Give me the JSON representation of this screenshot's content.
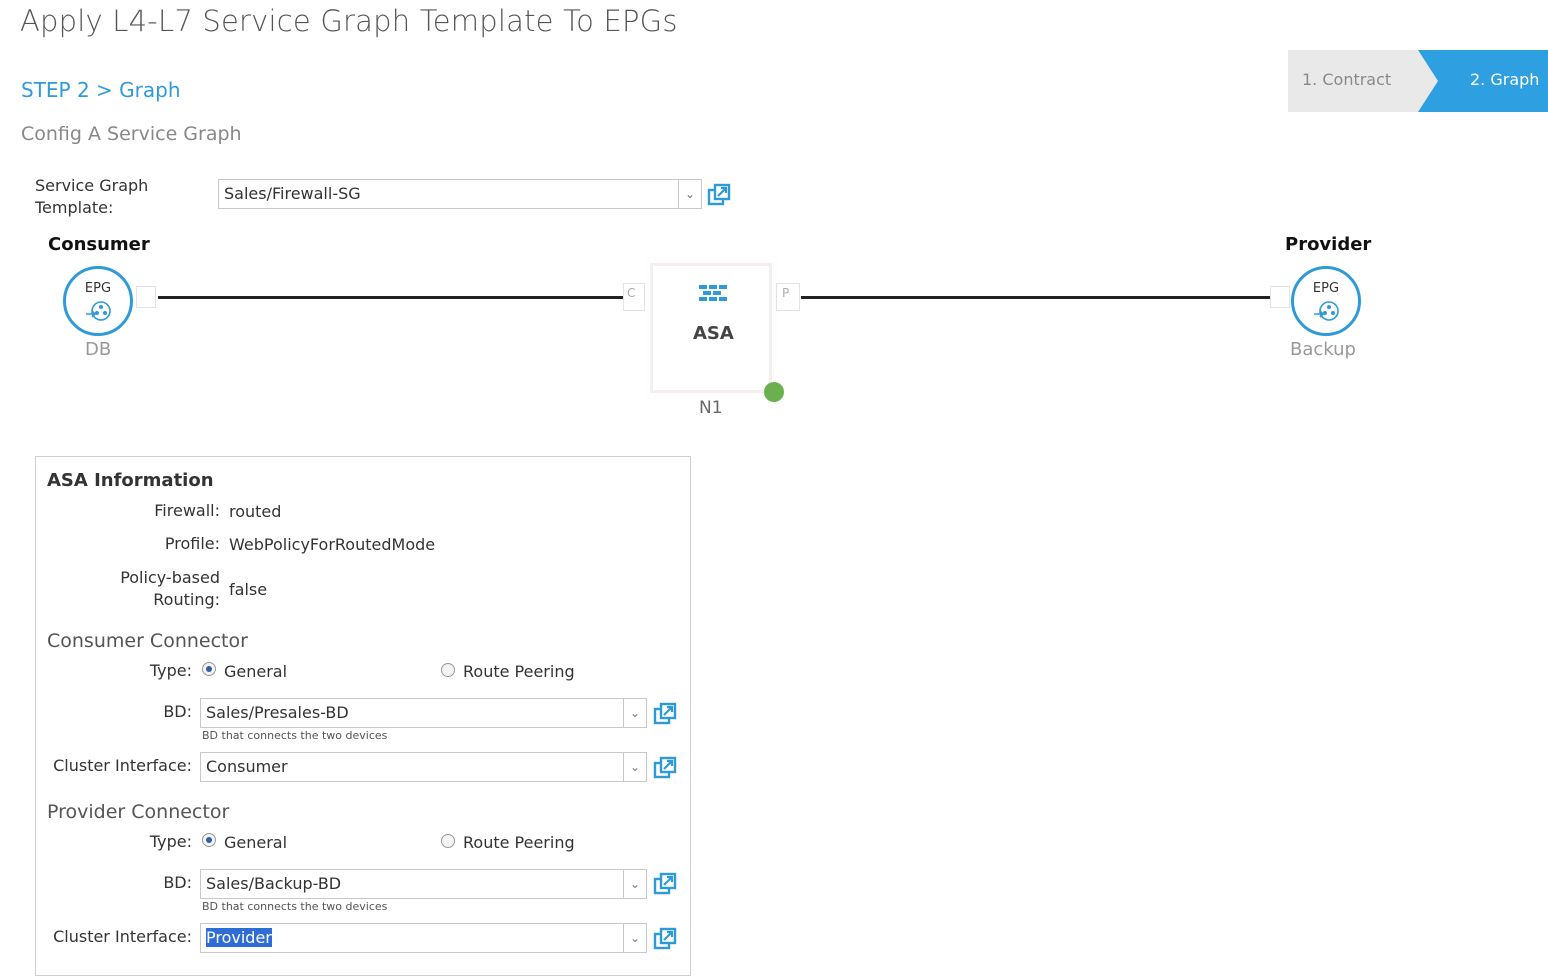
{
  "page": {
    "title": "Apply L4-L7 Service Graph Template To EPGs",
    "step": "STEP 2 > Graph",
    "subtitle": "Config A Service Graph"
  },
  "wizard": {
    "steps": [
      {
        "label": "1. Contract",
        "active": false
      },
      {
        "label": "2. Graph",
        "active": true
      }
    ],
    "active_color": "#2e9fe0"
  },
  "template": {
    "label": "Service Graph Template:",
    "value": "Sales/Firewall-SG"
  },
  "graph": {
    "consumer": {
      "heading": "Consumer",
      "badge": "EPG",
      "name": "DB"
    },
    "provider": {
      "heading": "Provider",
      "badge": "EPG",
      "name": "Backup"
    },
    "device": {
      "label": "ASA",
      "node": "N1",
      "consumer_port": "C",
      "provider_port": "P",
      "status_color": "#6ab04c"
    },
    "icon_color": "#2f9ad8"
  },
  "info": {
    "title": "ASA Information",
    "firewall": {
      "label": "Firewall:",
      "value": "routed"
    },
    "profile": {
      "label": "Profile:",
      "value": "WebPolicyForRoutedMode"
    },
    "pbr": {
      "label": "Policy-based Routing:",
      "value": "false"
    },
    "consumer_connector": {
      "heading": "Consumer Connector",
      "type_label": "Type:",
      "type_options": [
        "General",
        "Route Peering"
      ],
      "type_selected": "General",
      "bd_label": "BD:",
      "bd_value": "Sales/Presales-BD",
      "bd_help": "BD that connects the two devices",
      "cluster_label": "Cluster Interface:",
      "cluster_value": "Consumer"
    },
    "provider_connector": {
      "heading": "Provider Connector",
      "type_label": "Type:",
      "type_options": [
        "General",
        "Route Peering"
      ],
      "type_selected": "General",
      "bd_label": "BD:",
      "bd_value": "Sales/Backup-BD",
      "bd_help": "BD that connects the two devices",
      "cluster_label": "Cluster Interface:",
      "cluster_value": "Provider"
    }
  }
}
